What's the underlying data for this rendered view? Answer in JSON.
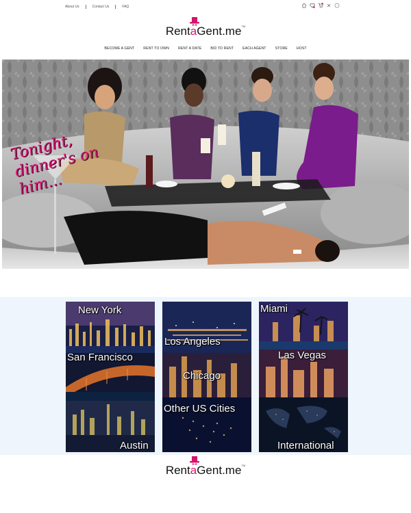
{
  "header": {
    "links": [
      "About Us",
      "Contact Us",
      "FAQ"
    ],
    "icons": [
      "home-icon",
      "heart-icon",
      "cart-icon",
      "close-icon"
    ]
  },
  "logo": {
    "part1": "Rent",
    "part2": "a",
    "part3": "Gent",
    "part4": ".me",
    "tm": "TM"
  },
  "nav": {
    "items": [
      "Become a Gent",
      "Rent to Own",
      "Rent a Date",
      "Bid to Rent",
      "Each Agent",
      "Store",
      "Host"
    ]
  },
  "hero": {
    "tagline": "Tonight, dinner's on him..."
  },
  "cities": {
    "col1": [
      "New York",
      "San Francisco",
      "Austin"
    ],
    "col2": [
      "Los Angeles",
      "Chicago",
      "Other US Cities"
    ],
    "col3": [
      "Miami",
      "Las Vegas",
      "International"
    ]
  },
  "colors": {
    "brand_pink": "#d4156e",
    "band_background": "#eef5fc"
  }
}
